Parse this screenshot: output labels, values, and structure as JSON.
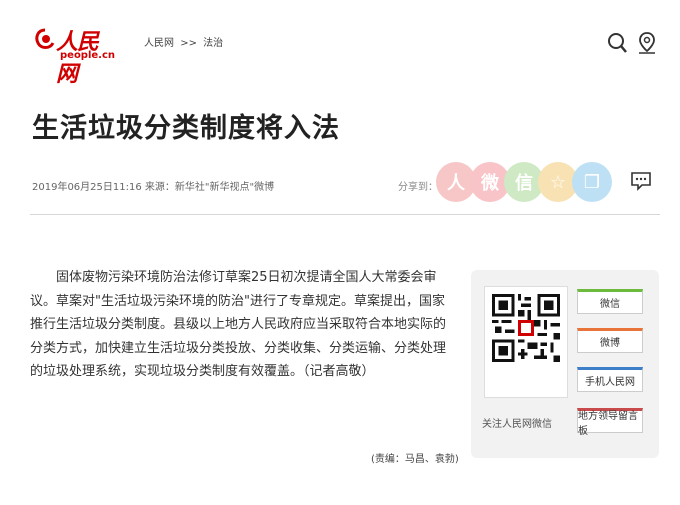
{
  "header": {
    "logo_cn": "人民网",
    "logo_en": "people.cn",
    "breadcrumb": [
      "人民网",
      ">>",
      "法治"
    ]
  },
  "article": {
    "title": "生活垃圾分类制度将入法",
    "meta": "2019年06月25日11:16  来源：新华社\"新华视点\"微博",
    "share_label": "分享到：",
    "body": "固体废物污染环境防治法修订草案25日初次提请全国人大常委会审议。草案对\"生活垃圾污染环境的防治\"进行了专章规定。草案提出，国家推行生活垃圾分类制度。县级以上地方人民政府应当采取符合本地实际的分类方式，加快建立生活垃圾分类投放、分类收集、分类运输、分类处理的垃圾处理系统，实现垃圾分类制度有效覆盖。（记者高敬）",
    "editor": "(责编：马昌、袁勃)"
  },
  "share_buttons": [
    {
      "name": "share-people-icon",
      "color": "#f7c6c6",
      "glyph": "人"
    },
    {
      "name": "share-weibo-icon",
      "color": "#f8c4c8",
      "glyph": "微"
    },
    {
      "name": "share-wechat-icon",
      "color": "#cfe9c4",
      "glyph": "信"
    },
    {
      "name": "share-qzone-icon",
      "color": "#f8e2b3",
      "glyph": "☆"
    },
    {
      "name": "share-copy-icon",
      "color": "#bde0f5",
      "glyph": "❐"
    }
  ],
  "sidebar": {
    "qr_caption": "关注人民网微信",
    "buttons": [
      {
        "label": "微信",
        "color": "#6dbb3c"
      },
      {
        "label": "微博",
        "color": "#e8743a"
      },
      {
        "label": "手机人民网",
        "color": "#3d7fc9"
      },
      {
        "label": "地方领导留言板",
        "color": "#c94a4a"
      }
    ]
  }
}
